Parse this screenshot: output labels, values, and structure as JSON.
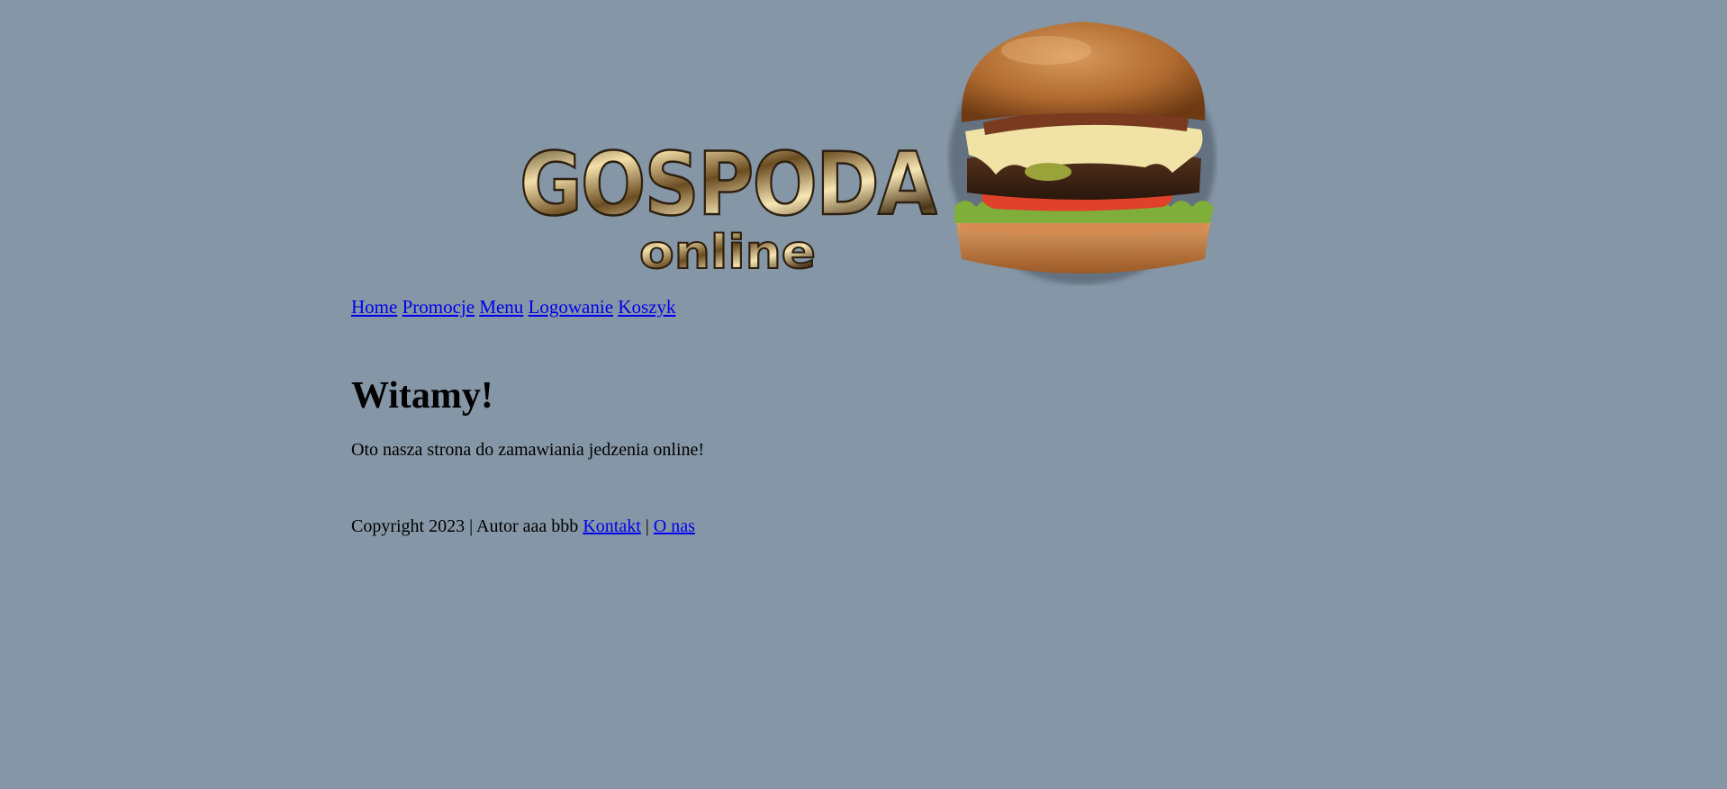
{
  "banner": {
    "logo_line1": "GOSPODA",
    "logo_line2": "online"
  },
  "nav": {
    "items": [
      "Home",
      "Promocje",
      "Menu",
      "Logowanie",
      "Koszyk"
    ]
  },
  "main": {
    "heading": "Witamy!",
    "intro": "Oto nasza strona do zamawiania jedzenia online!"
  },
  "footer": {
    "copyright": "Copyright 2023 | Autor aaa bbb ",
    "link_contact": "Kontakt",
    "separator": " | ",
    "link_about": "O nas"
  },
  "colors": {
    "background": "#8596a6",
    "link": "#0000ee"
  }
}
